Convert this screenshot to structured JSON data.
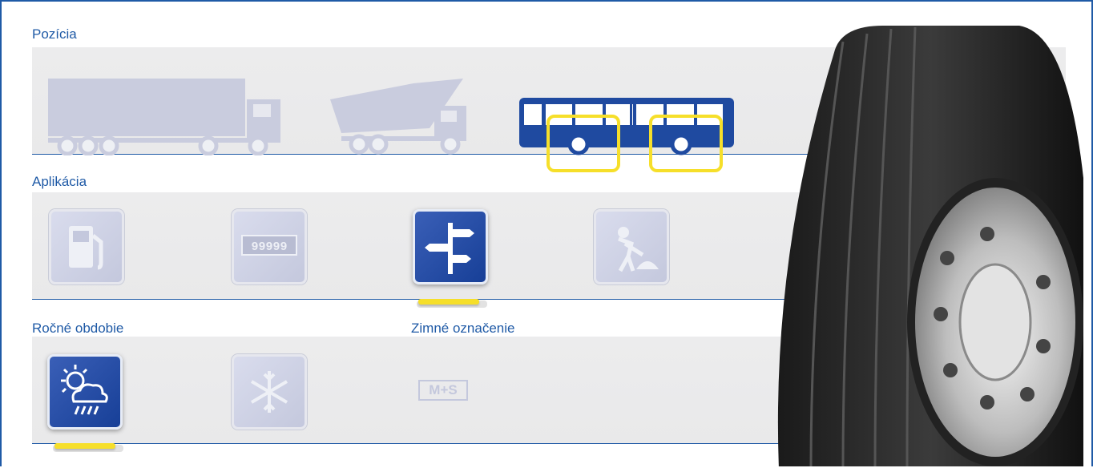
{
  "sections": {
    "position": {
      "title": "Pozícia"
    },
    "application": {
      "title": "Aplikácia"
    },
    "season": {
      "title": "Ročné obdobie"
    },
    "winter_mark": {
      "title": "Zimné označenie",
      "badge": "M+S"
    }
  },
  "vehicles": [
    {
      "name": "semi-truck-trailer",
      "active": false
    },
    {
      "name": "tipper-truck",
      "active": false
    },
    {
      "name": "city-bus",
      "active": true
    }
  ],
  "applications": [
    {
      "name": "fuel-pump-icon",
      "active": false
    },
    {
      "name": "odometer-icon",
      "active": false,
      "label": "99999"
    },
    {
      "name": "signpost-icon",
      "active": true
    },
    {
      "name": "road-worker-icon",
      "active": false
    }
  ],
  "seasons": [
    {
      "name": "sun-rain-icon",
      "active": true
    },
    {
      "name": "snowflake-icon",
      "active": false
    }
  ],
  "colors": {
    "brand_blue": "#1f5aa6",
    "highlight_yellow": "#f6df2a",
    "inactive_gray": "#c4c8dd"
  }
}
